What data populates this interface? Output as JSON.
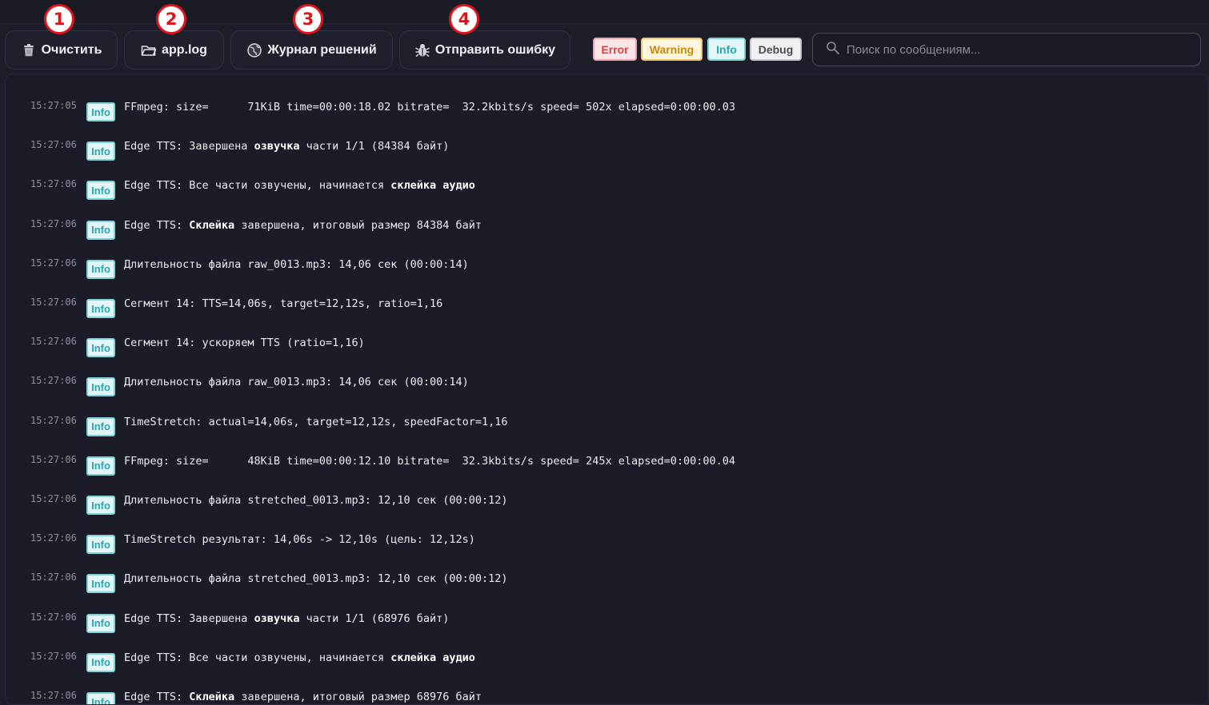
{
  "toolbar": {
    "clear_label": "Очистить",
    "applog_label": "app.log",
    "journal_label": "Журнал решений",
    "report_label": "Отправить ошибку",
    "markers": [
      "1",
      "2",
      "3",
      "4"
    ]
  },
  "filters": {
    "error": "Error",
    "warning": "Warning",
    "info": "Info",
    "debug": "Debug"
  },
  "search": {
    "placeholder": "Поиск по сообщениям..."
  },
  "colors": {
    "background": "#1d1e2a",
    "info_badge": "#2aa7b0",
    "error_badge": "#d9434d",
    "warning_badge": "#c98a0c",
    "marker": "#e0131b"
  },
  "log": [
    {
      "time": "15:27:05",
      "level": "Info",
      "parts": [
        {
          "t": "FFmpeg: size=      71KiB time=00:00:18.02 bitrate=  32.2kbits/s speed= 502x elapsed=0:00:00.03",
          "b": false
        }
      ]
    },
    {
      "time": "15:27:06",
      "level": "Info",
      "parts": [
        {
          "t": "Edge TTS: Завершена ",
          "b": false
        },
        {
          "t": "озвучка",
          "b": true
        },
        {
          "t": " части 1/1 (84384 байт)",
          "b": false
        }
      ]
    },
    {
      "time": "15:27:06",
      "level": "Info",
      "parts": [
        {
          "t": "Edge TTS: Все части озвучены, начинается ",
          "b": false
        },
        {
          "t": "склейка аудио",
          "b": true
        }
      ]
    },
    {
      "time": "15:27:06",
      "level": "Info",
      "parts": [
        {
          "t": "Edge TTS: ",
          "b": false
        },
        {
          "t": "Склейка",
          "b": true
        },
        {
          "t": " завершена, итоговый размер 84384 байт",
          "b": false
        }
      ]
    },
    {
      "time": "15:27:06",
      "level": "Info",
      "parts": [
        {
          "t": "Длительность файла raw_0013.mp3: 14,06 сек (00:00:14)",
          "b": false
        }
      ]
    },
    {
      "time": "15:27:06",
      "level": "Info",
      "parts": [
        {
          "t": "Сегмент 14: TTS=14,06s, target=12,12s, ratio=1,16",
          "b": false
        }
      ]
    },
    {
      "time": "15:27:06",
      "level": "Info",
      "parts": [
        {
          "t": "Сегмент 14: ускоряем TTS (ratio=1,16)",
          "b": false
        }
      ]
    },
    {
      "time": "15:27:06",
      "level": "Info",
      "parts": [
        {
          "t": "Длительность файла raw_0013.mp3: 14,06 сек (00:00:14)",
          "b": false
        }
      ]
    },
    {
      "time": "15:27:06",
      "level": "Info",
      "parts": [
        {
          "t": "TimeStretch: actual=14,06s, target=12,12s, speedFactor=1,16",
          "b": false
        }
      ]
    },
    {
      "time": "15:27:06",
      "level": "Info",
      "parts": [
        {
          "t": "FFmpeg: size=      48KiB time=00:00:12.10 bitrate=  32.3kbits/s speed= 245x elapsed=0:00:00.04",
          "b": false
        }
      ]
    },
    {
      "time": "15:27:06",
      "level": "Info",
      "parts": [
        {
          "t": "Длительность файла stretched_0013.mp3: 12,10 сек (00:00:12)",
          "b": false
        }
      ]
    },
    {
      "time": "15:27:06",
      "level": "Info",
      "parts": [
        {
          "t": "TimeStretch результат: 14,06s -> 12,10s (цель: 12,12s)",
          "b": false
        }
      ]
    },
    {
      "time": "15:27:06",
      "level": "Info",
      "parts": [
        {
          "t": "Длительность файла stretched_0013.mp3: 12,10 сек (00:00:12)",
          "b": false
        }
      ]
    },
    {
      "time": "15:27:06",
      "level": "Info",
      "parts": [
        {
          "t": "Edge TTS: Завершена ",
          "b": false
        },
        {
          "t": "озвучка",
          "b": true
        },
        {
          "t": " части 1/1 (68976 байт)",
          "b": false
        }
      ]
    },
    {
      "time": "15:27:06",
      "level": "Info",
      "parts": [
        {
          "t": "Edge TTS: Все части озвучены, начинается ",
          "b": false
        },
        {
          "t": "склейка аудио",
          "b": true
        }
      ]
    },
    {
      "time": "15:27:06",
      "level": "Info",
      "parts": [
        {
          "t": "Edge TTS: ",
          "b": false
        },
        {
          "t": "Склейка",
          "b": true
        },
        {
          "t": " завершена, итоговый размер 68976 байт",
          "b": false
        }
      ]
    }
  ]
}
